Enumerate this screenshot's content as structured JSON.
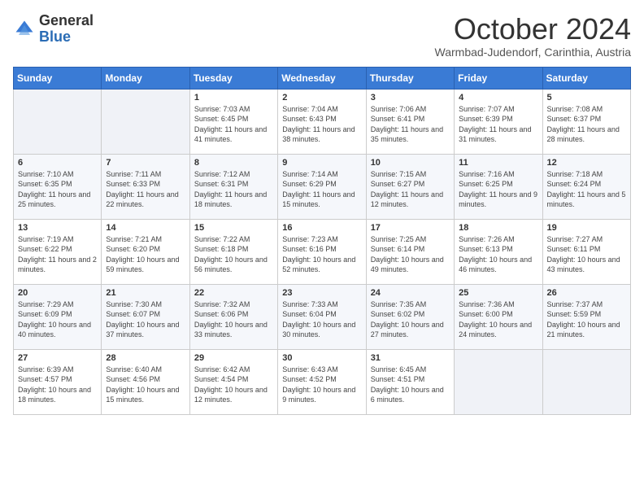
{
  "header": {
    "logo_general": "General",
    "logo_blue": "Blue",
    "month_title": "October 2024",
    "subtitle": "Warmbad-Judendorf, Carinthia, Austria"
  },
  "days_of_week": [
    "Sunday",
    "Monday",
    "Tuesday",
    "Wednesday",
    "Thursday",
    "Friday",
    "Saturday"
  ],
  "weeks": [
    [
      {
        "day": "",
        "info": ""
      },
      {
        "day": "",
        "info": ""
      },
      {
        "day": "1",
        "info": "Sunrise: 7:03 AM\nSunset: 6:45 PM\nDaylight: 11 hours and 41 minutes."
      },
      {
        "day": "2",
        "info": "Sunrise: 7:04 AM\nSunset: 6:43 PM\nDaylight: 11 hours and 38 minutes."
      },
      {
        "day": "3",
        "info": "Sunrise: 7:06 AM\nSunset: 6:41 PM\nDaylight: 11 hours and 35 minutes."
      },
      {
        "day": "4",
        "info": "Sunrise: 7:07 AM\nSunset: 6:39 PM\nDaylight: 11 hours and 31 minutes."
      },
      {
        "day": "5",
        "info": "Sunrise: 7:08 AM\nSunset: 6:37 PM\nDaylight: 11 hours and 28 minutes."
      }
    ],
    [
      {
        "day": "6",
        "info": "Sunrise: 7:10 AM\nSunset: 6:35 PM\nDaylight: 11 hours and 25 minutes."
      },
      {
        "day": "7",
        "info": "Sunrise: 7:11 AM\nSunset: 6:33 PM\nDaylight: 11 hours and 22 minutes."
      },
      {
        "day": "8",
        "info": "Sunrise: 7:12 AM\nSunset: 6:31 PM\nDaylight: 11 hours and 18 minutes."
      },
      {
        "day": "9",
        "info": "Sunrise: 7:14 AM\nSunset: 6:29 PM\nDaylight: 11 hours and 15 minutes."
      },
      {
        "day": "10",
        "info": "Sunrise: 7:15 AM\nSunset: 6:27 PM\nDaylight: 11 hours and 12 minutes."
      },
      {
        "day": "11",
        "info": "Sunrise: 7:16 AM\nSunset: 6:25 PM\nDaylight: 11 hours and 9 minutes."
      },
      {
        "day": "12",
        "info": "Sunrise: 7:18 AM\nSunset: 6:24 PM\nDaylight: 11 hours and 5 minutes."
      }
    ],
    [
      {
        "day": "13",
        "info": "Sunrise: 7:19 AM\nSunset: 6:22 PM\nDaylight: 11 hours and 2 minutes."
      },
      {
        "day": "14",
        "info": "Sunrise: 7:21 AM\nSunset: 6:20 PM\nDaylight: 10 hours and 59 minutes."
      },
      {
        "day": "15",
        "info": "Sunrise: 7:22 AM\nSunset: 6:18 PM\nDaylight: 10 hours and 56 minutes."
      },
      {
        "day": "16",
        "info": "Sunrise: 7:23 AM\nSunset: 6:16 PM\nDaylight: 10 hours and 52 minutes."
      },
      {
        "day": "17",
        "info": "Sunrise: 7:25 AM\nSunset: 6:14 PM\nDaylight: 10 hours and 49 minutes."
      },
      {
        "day": "18",
        "info": "Sunrise: 7:26 AM\nSunset: 6:13 PM\nDaylight: 10 hours and 46 minutes."
      },
      {
        "day": "19",
        "info": "Sunrise: 7:27 AM\nSunset: 6:11 PM\nDaylight: 10 hours and 43 minutes."
      }
    ],
    [
      {
        "day": "20",
        "info": "Sunrise: 7:29 AM\nSunset: 6:09 PM\nDaylight: 10 hours and 40 minutes."
      },
      {
        "day": "21",
        "info": "Sunrise: 7:30 AM\nSunset: 6:07 PM\nDaylight: 10 hours and 37 minutes."
      },
      {
        "day": "22",
        "info": "Sunrise: 7:32 AM\nSunset: 6:06 PM\nDaylight: 10 hours and 33 minutes."
      },
      {
        "day": "23",
        "info": "Sunrise: 7:33 AM\nSunset: 6:04 PM\nDaylight: 10 hours and 30 minutes."
      },
      {
        "day": "24",
        "info": "Sunrise: 7:35 AM\nSunset: 6:02 PM\nDaylight: 10 hours and 27 minutes."
      },
      {
        "day": "25",
        "info": "Sunrise: 7:36 AM\nSunset: 6:00 PM\nDaylight: 10 hours and 24 minutes."
      },
      {
        "day": "26",
        "info": "Sunrise: 7:37 AM\nSunset: 5:59 PM\nDaylight: 10 hours and 21 minutes."
      }
    ],
    [
      {
        "day": "27",
        "info": "Sunrise: 6:39 AM\nSunset: 4:57 PM\nDaylight: 10 hours and 18 minutes."
      },
      {
        "day": "28",
        "info": "Sunrise: 6:40 AM\nSunset: 4:56 PM\nDaylight: 10 hours and 15 minutes."
      },
      {
        "day": "29",
        "info": "Sunrise: 6:42 AM\nSunset: 4:54 PM\nDaylight: 10 hours and 12 minutes."
      },
      {
        "day": "30",
        "info": "Sunrise: 6:43 AM\nSunset: 4:52 PM\nDaylight: 10 hours and 9 minutes."
      },
      {
        "day": "31",
        "info": "Sunrise: 6:45 AM\nSunset: 4:51 PM\nDaylight: 10 hours and 6 minutes."
      },
      {
        "day": "",
        "info": ""
      },
      {
        "day": "",
        "info": ""
      }
    ]
  ]
}
